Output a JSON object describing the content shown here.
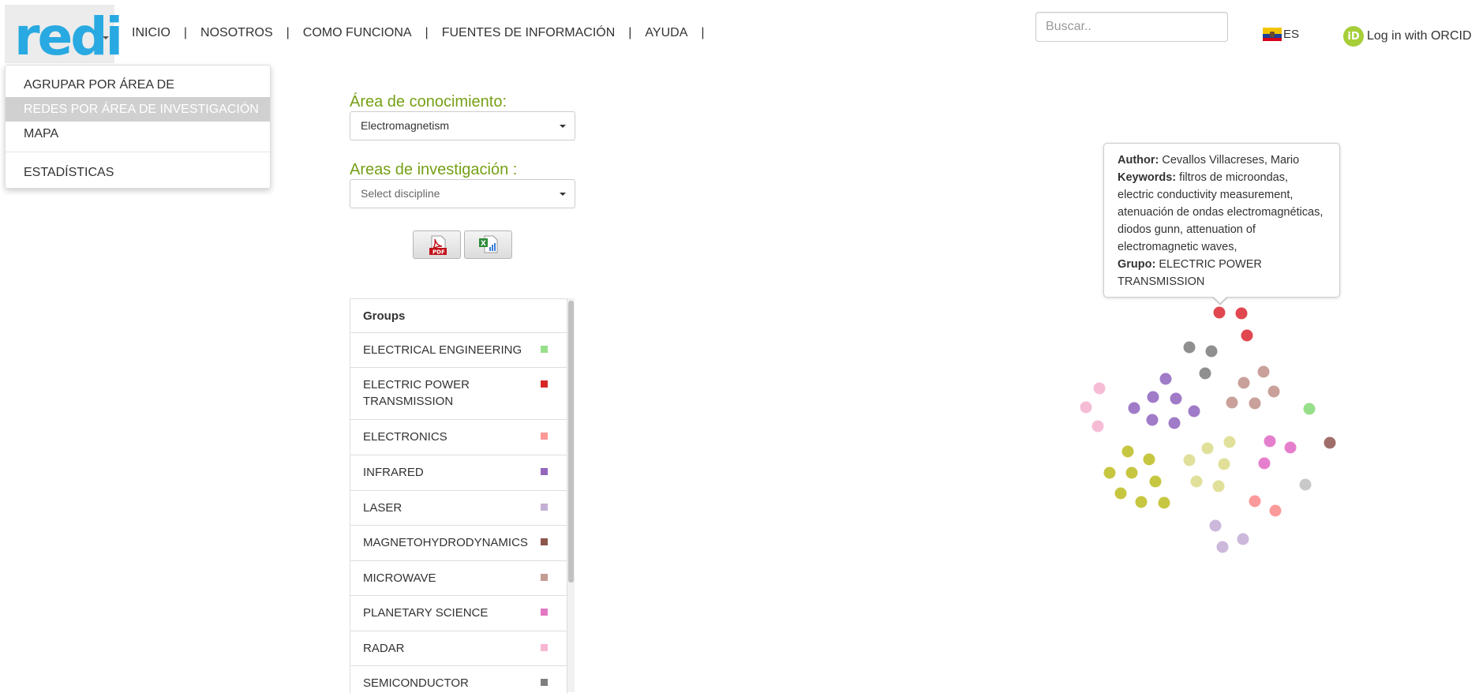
{
  "logo": {
    "text": "redi"
  },
  "nav": {
    "items": [
      "INICIO",
      "NOSOTROS",
      "COMO FUNCIONA",
      "FUENTES DE INFORMACIÓN",
      "AYUDA"
    ],
    "separator": "|"
  },
  "search": {
    "placeholder": "Buscar.."
  },
  "language": {
    "code": "ES"
  },
  "login": {
    "label": "Log in with ORCID",
    "icon_text": "iD"
  },
  "dropdown": {
    "items": [
      "AGRUPAR POR ÁREA DE CONOCIMIENTO",
      "REDES POR ÁREA DE INVESTIGACIÓN",
      "MAPA",
      "ESTADÍSTICAS"
    ],
    "active_index": 1
  },
  "form": {
    "knowledge_area_label": "Área de conocimiento:",
    "knowledge_area_value": "Electromagnetism",
    "research_area_label": "Areas de investigación :",
    "research_area_placeholder": "Select discipline",
    "export_pdf_icon": "pdf-icon",
    "export_excel_icon": "excel-icon"
  },
  "groups": {
    "header": "Groups",
    "items": [
      {
        "name": "ELECTRICAL ENGINEERING",
        "color": "#98df8a"
      },
      {
        "name": "ELECTRIC POWER TRANSMISSION",
        "color": "#d62728"
      },
      {
        "name": "ELECTRONICS",
        "color": "#ff9896"
      },
      {
        "name": "INFRARED",
        "color": "#9467bd"
      },
      {
        "name": "LASER",
        "color": "#c5b0d5"
      },
      {
        "name": "MAGNETOHYDRODYNAMICS",
        "color": "#8c564b"
      },
      {
        "name": "MICROWAVE",
        "color": "#c49c94"
      },
      {
        "name": "PLANETARY SCIENCE",
        "color": "#e377c2"
      },
      {
        "name": "RADAR",
        "color": "#f7b6d2"
      },
      {
        "name": "SEMICONDUCTOR",
        "color": "#7f7f7f"
      }
    ]
  },
  "tooltip": {
    "author_label": "Author:",
    "author": "Cevallos Villacreses, Mario",
    "keywords_label": "Keywords:",
    "keywords": "filtros de microondas, electric conductivity measurement, atenuación de ondas electromagnéticas, diodos gunn, attenuation of electromagnetic waves,",
    "group_label": "Grupo:",
    "group": "ELECTRIC POWER TRANSMISSION"
  },
  "network": {
    "colors": {
      "red": "#e0474f",
      "gray": "#8f8f8f",
      "purple": "#a07bc8",
      "tan": "#c9a19a",
      "pink": "#f6bcd6",
      "lightgreen": "#98df8a",
      "brown": "#a06e6a",
      "olive": "#c7c641",
      "paleolive": "#e1e09a",
      "magenta": "#e57fcd",
      "silver": "#c9c9c9",
      "salmon": "#fb9a9a",
      "lavender": "#cbb8db"
    }
  }
}
